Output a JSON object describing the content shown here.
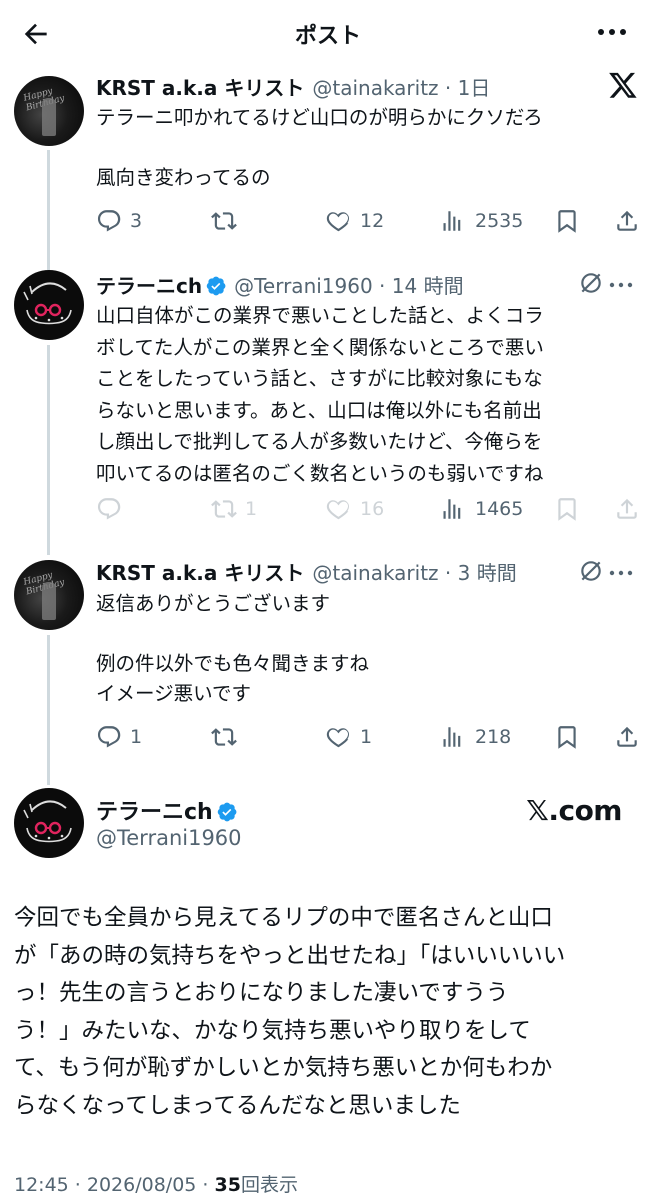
{
  "header": {
    "title": "ポスト"
  },
  "tweets": [
    {
      "name": "KRST a.k.a キリスト",
      "handle": "@tainakaritz",
      "time": "1日",
      "text_lines": [
        "テラーニ叩かれてるけど山口のが明らかにクソだろ",
        "",
        "風向き変わってるの"
      ],
      "replies": "3",
      "likes": "12",
      "views": "2535"
    },
    {
      "name": "テラーニch",
      "handle": "@Terrani1960",
      "time": "14 時間",
      "text_lines": [
        "山口自体がこの業界で悪いことした話と、よくコラ",
        "ボしてた人がこの業界と全く関係ないところで悪い",
        "ことをしたっていう話と、さすがに比較対象にもな",
        "らないと思います。あと、山口は俺以外にも名前出",
        "し顔出しで批判してる人が多数いたけど、今俺らを",
        "叩いてるのは匿名のごく数名というのも弱いですね"
      ],
      "reposts": "1",
      "likes": "16",
      "views": "1465"
    },
    {
      "name": "KRST a.k.a キリスト",
      "handle": "@tainakaritz",
      "time": "3 時間",
      "text_lines": [
        "返信ありがとうございます",
        "",
        "例の件以外でも色々聞きますね",
        "イメージ悪いです"
      ],
      "replies": "1",
      "likes": "1",
      "views": "218"
    }
  ],
  "main_post": {
    "name": "テラーニch",
    "handle": "@Terrani1960",
    "watermark": "𝕏.com",
    "text_lines": [
      "今回でも全員から見えてるリプの中で匿名さんと山口",
      "が「あの時の気持ちをやっと出せたね」「はいいいいい",
      "っ！先生の言うとおりになりました凄いですうう",
      "う！」みたいな、かなり気持ち悪いやり取りをして",
      "て、もう何が恥ずかしいとか気持ち悪いとか何もわか",
      "らなくなってしまってるんだなと思いました"
    ],
    "timestamp": "12:45 · 2026/08/05 · ",
    "view_count": "35",
    "view_label": "回表示"
  },
  "avatar_text": {
    "krst_script": "Happy Birthday"
  },
  "colors": {
    "text": "#0f1419",
    "secondary": "#536471",
    "verified": "#1d9bf0",
    "line": "#cfd9de"
  }
}
